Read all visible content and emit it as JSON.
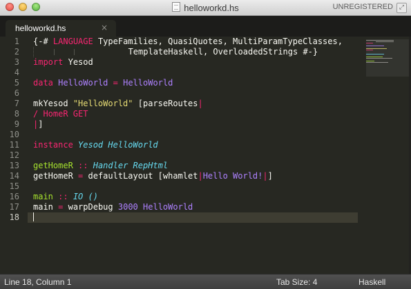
{
  "window": {
    "title": "helloworkd.hs",
    "registration": "UNREGISTERED"
  },
  "tab": {
    "label": "helloworkd.hs",
    "close_glyph": "×"
  },
  "gutter": {
    "line_numbers": [
      "1",
      "2",
      "3",
      "4",
      "5",
      "6",
      "7",
      "8",
      "9",
      "10",
      "11",
      "12",
      "13",
      "14",
      "15",
      "16",
      "17",
      "18"
    ],
    "current_line": "18"
  },
  "code": {
    "l1": {
      "open": "{-#",
      "pragma": "LANGUAGE",
      "rest": "TypeFamilies, QuasiQuotes, MultiParamTypeClasses,"
    },
    "l2": {
      "rest": "TemplateHaskell, OverloadedStrings #-}"
    },
    "l3": {
      "kw": "import",
      "rest": "Yesod"
    },
    "l5": {
      "kw": "data",
      "type": "HelloWorld",
      "eq": "=",
      "ctor": "HelloWorld"
    },
    "l7": {
      "fn": "mkYesod",
      "str": "\"HelloWorld\"",
      "open": "[parseRoutes",
      "bar": "|"
    },
    "l8": {
      "route": "/ HomeR GET"
    },
    "l9": {
      "bar": "|",
      "close": "]"
    },
    "l11": {
      "kw": "instance",
      "cls": "Yesod",
      "type": "HelloWorld"
    },
    "l13": {
      "fn": "getHomeR",
      "op": "::",
      "t1": "Handler",
      "t2": "RepHtml"
    },
    "l14": {
      "fn": "getHomeR",
      "eq": "=",
      "body": "defaultLayout [whamlet",
      "bar1": "|",
      "quote": "Hello World!",
      "bar2": "|",
      "close": "]"
    },
    "l16": {
      "fn": "main",
      "op": "::",
      "t1": "IO",
      "unit": "()"
    },
    "l17": {
      "fn": "main",
      "eq": "=",
      "body": "warpDebug",
      "num": "3000",
      "ctor": "HelloWorld"
    }
  },
  "status": {
    "position": "Line 18, Column 1",
    "tab_size": "Tab Size: 4",
    "syntax": "Haskell"
  },
  "colors": {
    "background": "#272822",
    "keyword": "#f92672",
    "type": "#ae81ff",
    "string": "#e6db74",
    "function": "#a6e22e",
    "class": "#66d9ef",
    "gutter": "#8f908a",
    "current_line": "#3e3d32"
  },
  "icons": {
    "close_window": "traffic-light-close",
    "minimize": "traffic-light-minimize",
    "maximize": "traffic-light-maximize",
    "document": "document-icon",
    "fullscreen": "fullscreen-icon"
  }
}
